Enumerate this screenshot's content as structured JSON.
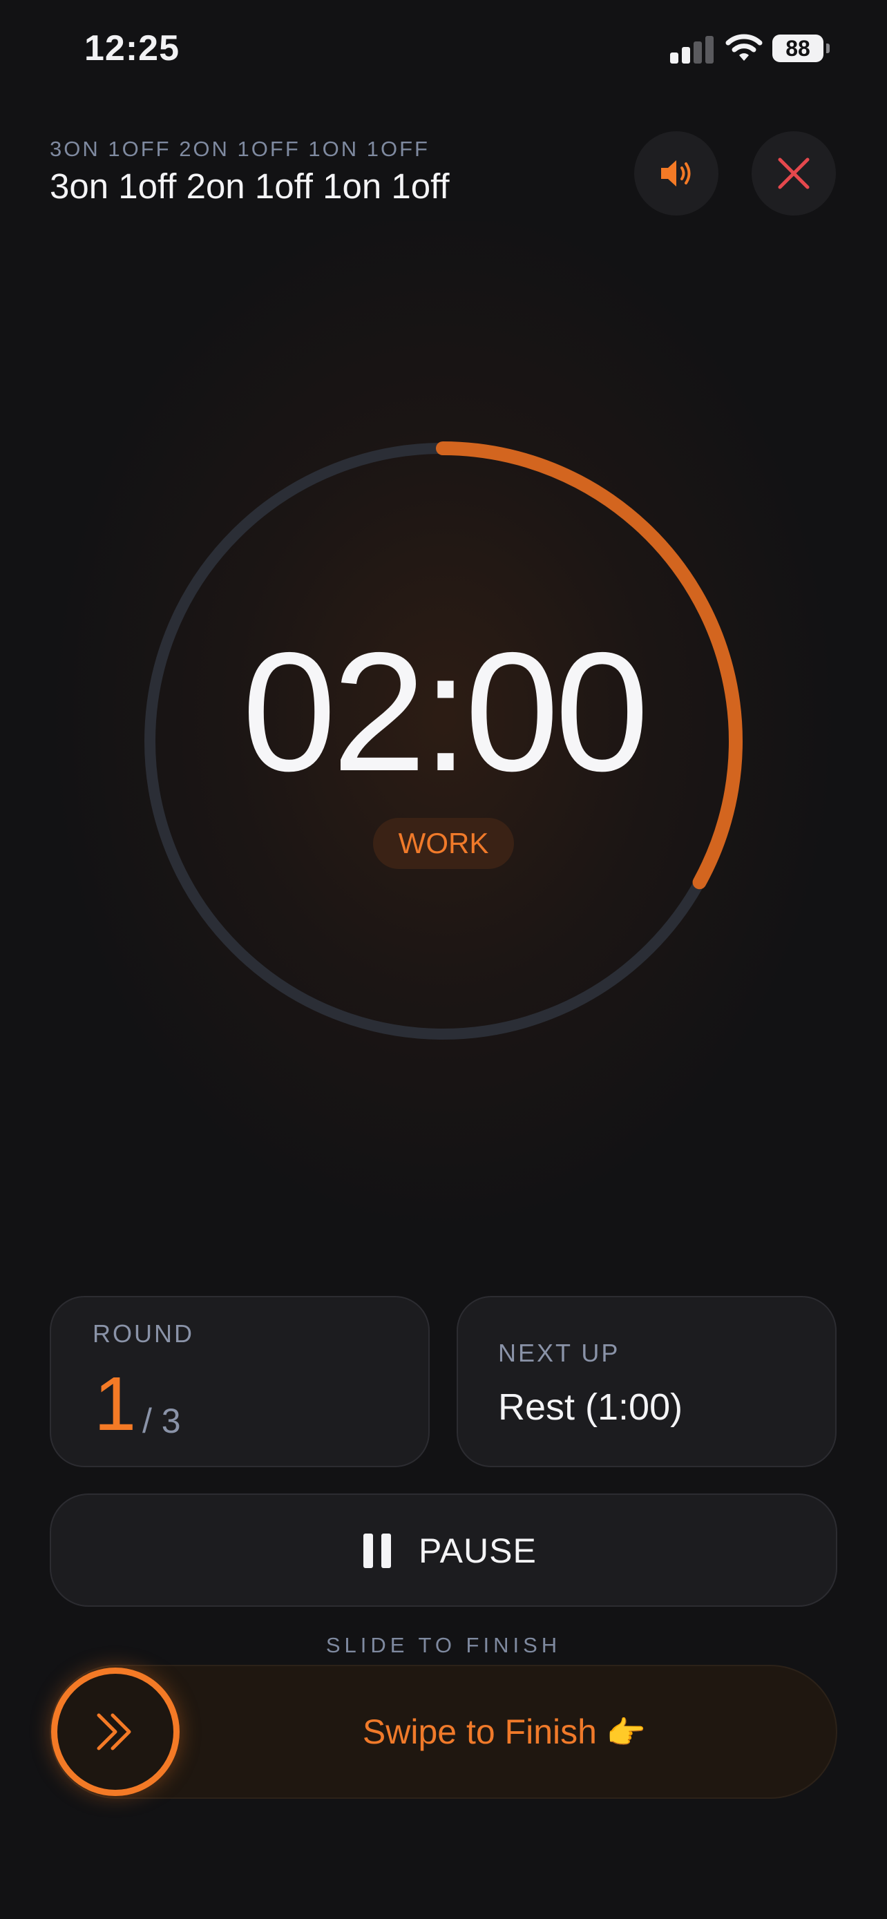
{
  "status_bar": {
    "time": "12:25",
    "battery": "88"
  },
  "header": {
    "subtitle": "3ON 1OFF 2ON 1OFF 1ON 1OFF",
    "title": "3on 1off 2on 1off 1on 1off"
  },
  "timer": {
    "time": "02:00",
    "phase": "WORK",
    "progress_fraction": 0.33
  },
  "round_card": {
    "label": "ROUND",
    "current": "1",
    "total": "/ 3"
  },
  "next_card": {
    "label": "NEXT UP",
    "value": "Rest (1:00)"
  },
  "controls": {
    "pause_label": "PAUSE",
    "slide_hint": "SLIDE TO FINISH",
    "swipe_label": "Swipe to Finish",
    "swipe_emoji": "👉"
  },
  "colors": {
    "accent": "#f47a26",
    "ring_track": "#2b2e36",
    "close": "#e5484d",
    "background": "#121214"
  },
  "icons": {
    "sound": "speaker-icon",
    "close": "close-icon",
    "pause": "pause-icon",
    "finish": "double-chevron-right-icon"
  }
}
